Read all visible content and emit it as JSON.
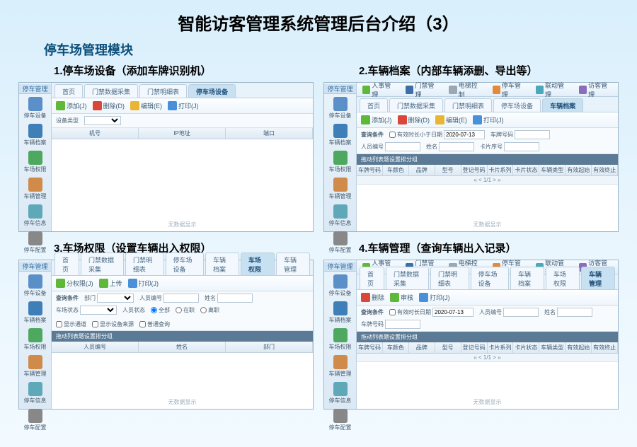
{
  "page_title": "智能访客管理系统管理后台介绍（3）",
  "module_title": "停车场管理模块",
  "panels": [
    {
      "caption": "1.停车场设备（添加车牌识别机）",
      "sidebar_title": "停车管理",
      "sidebar": [
        "停车设备",
        "车辆档案",
        "车场权限",
        "车辆管理",
        "停车信息",
        "停车配置"
      ],
      "tabs": [
        "首页",
        "门禁数据采集",
        "门禁明细表",
        "停车场设备"
      ],
      "active_tab": 3,
      "toolbar": [
        {
          "icon": "green",
          "label": "添加(J)"
        },
        {
          "icon": "red",
          "label": "删除(D)"
        },
        {
          "icon": "yellow",
          "label": "编辑(E)"
        },
        {
          "icon": "blue",
          "label": "打印(J)"
        }
      ],
      "filter_simple": {
        "label": "设备类型",
        "button": ""
      },
      "columns": [
        "机号",
        "IP地址",
        "端口"
      ],
      "empty": "无数据显示"
    },
    {
      "caption": "2.车辆档案（内部车辆添删、导出等）",
      "topnav": [
        {
          "icon": "green",
          "label": "人事管理"
        },
        {
          "icon": "navy",
          "label": "门禁管理"
        },
        {
          "icon": "gray",
          "label": "电梯控制"
        },
        {
          "icon": "orange",
          "label": "停车管理"
        },
        {
          "icon": "teal",
          "label": "联动管理"
        },
        {
          "icon": "purple",
          "label": "访客管理"
        }
      ],
      "sidebar_title": "停车管理",
      "sidebar": [
        "停车设备",
        "车辆档案",
        "车场权限",
        "车辆管理",
        "停车信息",
        "停车配置"
      ],
      "tabs": [
        "首页",
        "门禁数据采集",
        "门禁明细表",
        "停车场设备",
        "车辆档案"
      ],
      "active_tab": 4,
      "toolbar": [
        {
          "icon": "green",
          "label": "添加(J)"
        },
        {
          "icon": "red",
          "label": "删除(D)"
        },
        {
          "icon": "yellow",
          "label": "编辑(E)"
        },
        {
          "icon": "blue",
          "label": "打印(J)"
        }
      ],
      "filter_label": "查询条件",
      "filter_fields": [
        {
          "label": "有效时长小于日期",
          "value": "2020-07-13",
          "type": "date"
        },
        {
          "label": "车牌号码",
          "value": ""
        },
        {
          "label": "人员编号",
          "value": ""
        },
        {
          "label": "姓名",
          "value": ""
        },
        {
          "label": "卡片序号",
          "value": ""
        }
      ],
      "darkbar": "拖动列表题设置排分组",
      "columns": [
        "车牌号码",
        "车颜色",
        "品牌",
        "型号",
        "登记号码",
        "卡片系列号",
        "卡片状态",
        "车辆类型",
        "有效起始日期",
        "有效终止日期"
      ],
      "pager": "« < 1/1 > »",
      "empty": "无数据显示"
    },
    {
      "caption": "3.车场权限（设置车辆出入权限）",
      "sidebar_title": "停车管理",
      "sidebar": [
        "停车设备",
        "车辆档案",
        "车场权限",
        "车辆管理",
        "停车信息",
        "停车配置"
      ],
      "tabs": [
        "首页",
        "门禁数据采集",
        "门禁明细表",
        "停车场设备",
        "车辆档案",
        "车场权限",
        "车辆管理"
      ],
      "active_tab": 5,
      "toolbar": [
        {
          "icon": "green",
          "label": "分权限(J)"
        },
        {
          "icon": "green",
          "label": "上传"
        },
        {
          "icon": "blue",
          "label": "打印(J)"
        }
      ],
      "filter_label": "查询条件",
      "filter_row1": [
        {
          "label": "部门",
          "type": "select"
        },
        {
          "label": "人员编号",
          "type": "text"
        },
        {
          "label": "姓名",
          "type": "text"
        },
        {
          "label": "车场状态",
          "type": "select"
        }
      ],
      "filter_radios": {
        "label": "人员状态",
        "options": [
          "全部",
          "在职",
          "离职"
        ]
      },
      "filter_row2_checks": [
        "显示通道",
        "显示设备来源",
        "普通查询"
      ],
      "darkbar": "拖动列表题设置排分组",
      "columns": [
        "人员编号",
        "姓名",
        "部门"
      ],
      "empty": "无数据显示"
    },
    {
      "caption": "4.车辆管理（查询车辆出入记录）",
      "topnav": [
        {
          "icon": "green",
          "label": "人事管理"
        },
        {
          "icon": "navy",
          "label": "门禁管理"
        },
        {
          "icon": "gray",
          "label": "电梯控制"
        },
        {
          "icon": "orange",
          "label": "停车管理"
        },
        {
          "icon": "teal",
          "label": "联动管理"
        },
        {
          "icon": "purple",
          "label": "访客管理"
        }
      ],
      "sidebar_title": "停车管理",
      "sidebar": [
        "停车设备",
        "车辆档案",
        "车场权限",
        "车辆管理",
        "停车信息",
        "停车配置"
      ],
      "tabs": [
        "首页",
        "门禁数据采集",
        "门禁明细表",
        "停车场设备",
        "车辆档案",
        "车场权限",
        "车辆管理"
      ],
      "active_tab": 6,
      "toolbar": [
        {
          "icon": "red",
          "label": "删除"
        },
        {
          "icon": "green",
          "label": "审核"
        },
        {
          "icon": "blue",
          "label": "打印(J)"
        }
      ],
      "filter_label": "查询条件",
      "filter_fields": [
        {
          "label": "有效时长日期",
          "value": "2020-07-13",
          "type": "date"
        },
        {
          "label": "人员编号",
          "value": ""
        },
        {
          "label": "姓名",
          "value": ""
        },
        {
          "label": "车牌号码",
          "value": ""
        }
      ],
      "darkbar": "拖动列表题设置排分组",
      "columns": [
        "车牌号码",
        "车颜色",
        "品牌",
        "型号",
        "登记号码",
        "卡片系列号",
        "卡片状态",
        "车辆类型",
        "有效起始日期",
        "有效终止日期"
      ],
      "pager": "« < 1/1 > »",
      "empty": "无数据显示"
    }
  ]
}
